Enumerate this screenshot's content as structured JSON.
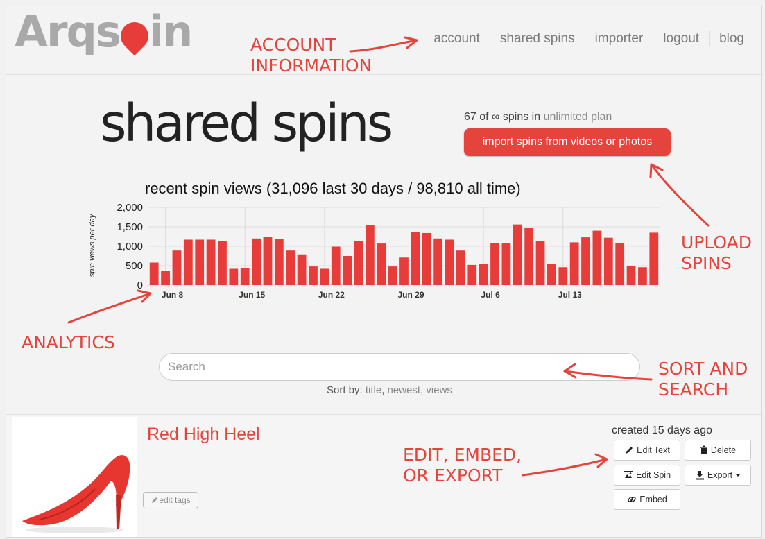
{
  "brand": {
    "logo_text_left": "Arqs",
    "logo_text_right": "in"
  },
  "nav": {
    "items": [
      "account",
      "shared spins",
      "importer",
      "logout",
      "blog"
    ]
  },
  "page": {
    "title": "shared spins",
    "plan_count": "67 of ∞ spins in",
    "plan_name": "unlimited plan",
    "import_button": "import spins from videos or photos"
  },
  "chart_data": {
    "type": "bar",
    "title": "recent spin views (31,096 last 30 days / 98,810 all time)",
    "ylabel": "spin views per day",
    "ylim": [
      0,
      2000
    ],
    "yticks": [
      "0",
      "500",
      "1,000",
      "1,500",
      "2,000"
    ],
    "xtick_labels": [
      "Jun 8",
      "Jun 15",
      "Jun 22",
      "Jun 29",
      "Jul 6",
      "Jul 13"
    ],
    "xtick_bar_index": [
      1,
      8,
      15,
      22,
      29,
      36
    ],
    "values": [
      580,
      370,
      890,
      1170,
      1170,
      1170,
      1130,
      420,
      440,
      1200,
      1250,
      1180,
      890,
      790,
      480,
      420,
      990,
      750,
      1130,
      1550,
      1070,
      480,
      710,
      1370,
      1340,
      1200,
      1170,
      890,
      520,
      540,
      1080,
      1080,
      1560,
      1480,
      1140,
      540,
      460,
      1100,
      1230,
      1400,
      1220,
      1090,
      500,
      460,
      1350
    ],
    "bar_color": "#e83c3a"
  },
  "annotations": {
    "account": "ACCOUNT\nINFORMATION",
    "upload": "UPLOAD\nSPINS",
    "analytics": "ANALYTICS",
    "sort": "SORT AND\nSEARCH",
    "edit": "EDIT, EMBED,\nOR EXPORT"
  },
  "search": {
    "placeholder": "Search"
  },
  "sort": {
    "label": "Sort by:",
    "options": [
      "title",
      "newest",
      "views"
    ]
  },
  "item": {
    "title": "Red High Heel",
    "edit_tags": "edit tags",
    "created": "created 15 days ago",
    "buttons": {
      "edit_text": "Edit Text",
      "delete": "Delete",
      "edit_spin": "Edit Spin",
      "export": "Export",
      "embed": "Embed"
    }
  },
  "colors": {
    "accent": "#e5443d",
    "logo_gray": "#a9a9a9"
  }
}
